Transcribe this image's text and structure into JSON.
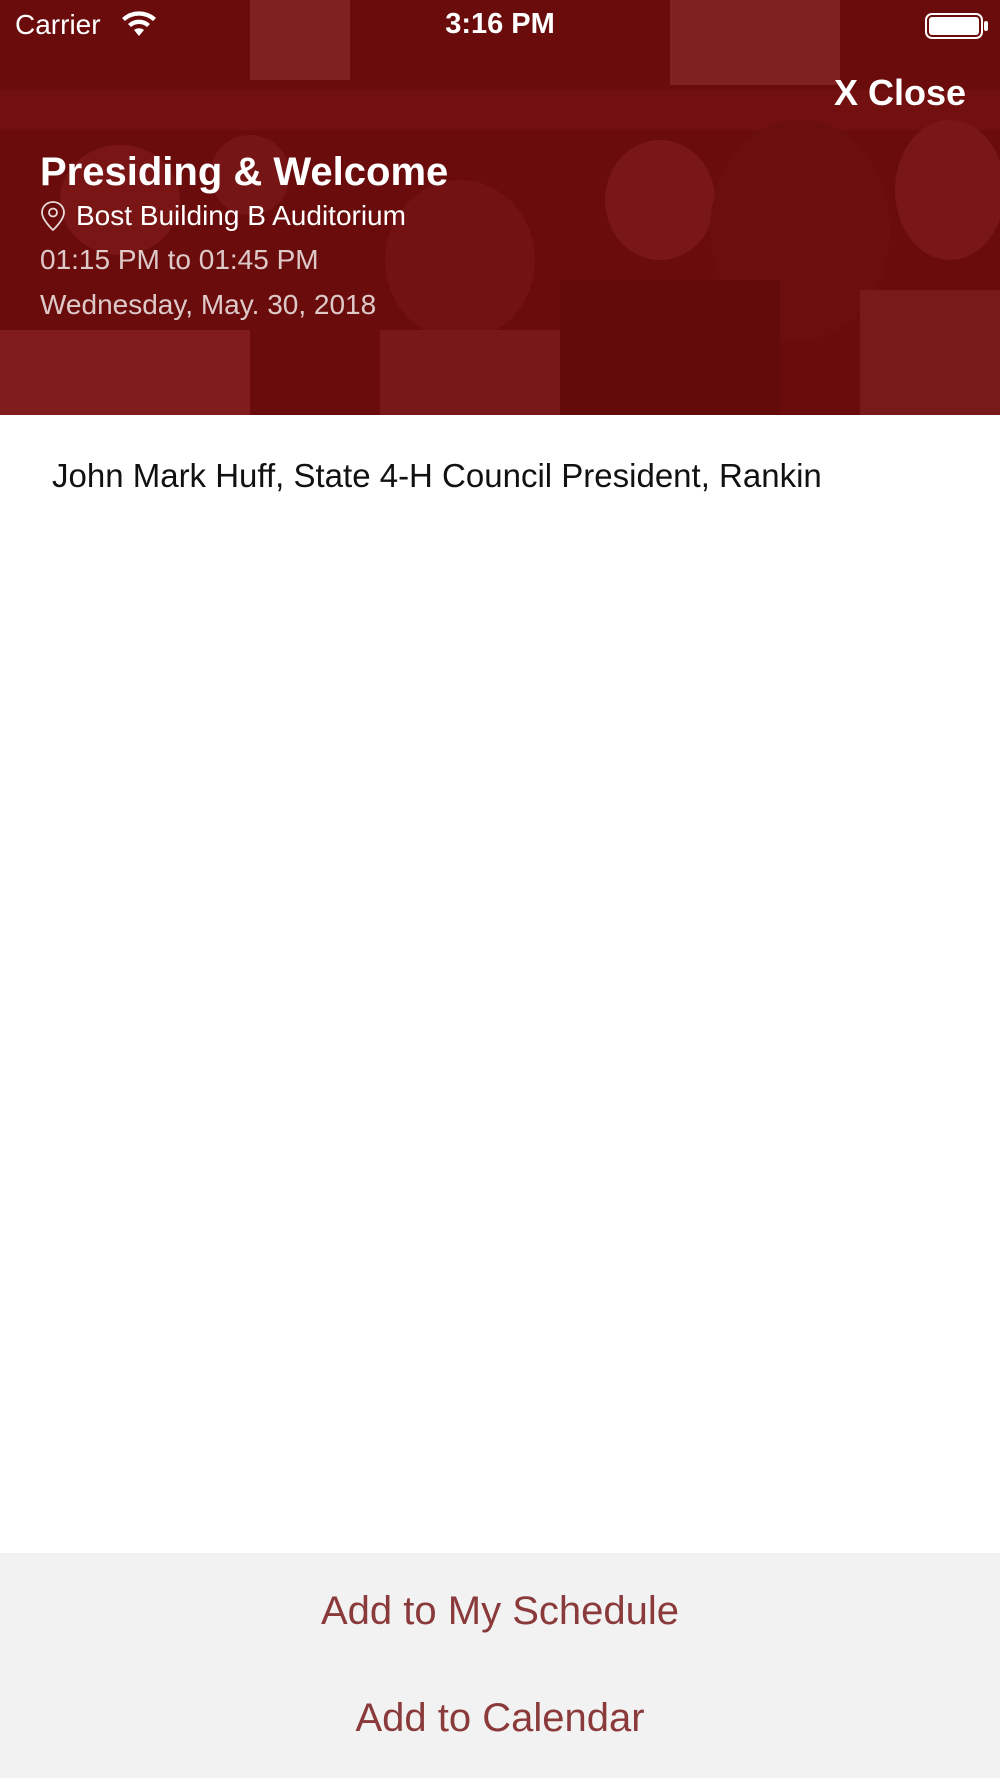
{
  "status_bar": {
    "carrier": "Carrier",
    "time": "3:16 PM"
  },
  "header": {
    "close_label": "X Close",
    "title": "Presiding & Welcome",
    "location": "Bost Building B Auditorium",
    "time_range": "01:15 PM to 01:45 PM",
    "date": "Wednesday, May. 30, 2018"
  },
  "content": {
    "description": "John Mark Huff, State 4-H Council President, Rankin"
  },
  "actions": {
    "add_schedule_label": "Add to My Schedule",
    "add_calendar_label": "Add to Calendar"
  },
  "colors": {
    "hero_tint": "#6e1010",
    "action_text": "#8a3a3a",
    "action_background": "#f2f2f2"
  },
  "icons": {
    "wifi": "wifi-icon",
    "battery": "battery-icon",
    "location": "map-pin-icon",
    "hero_image": "audience-photo"
  }
}
